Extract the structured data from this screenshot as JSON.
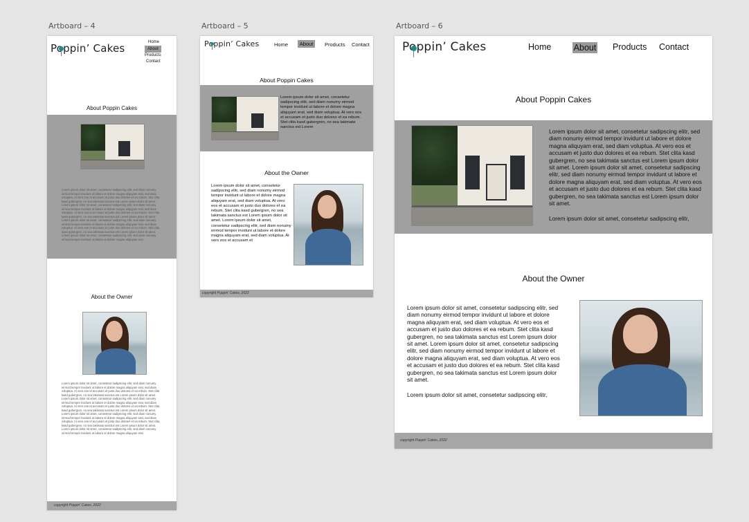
{
  "artboards": [
    {
      "label": "Artboard – 4"
    },
    {
      "label": "Artboard – 5"
    },
    {
      "label": "Artboard – 6"
    }
  ],
  "site": {
    "logo_text": "Poppin’ Cakes",
    "nav": [
      "Home",
      "About",
      "Products",
      "Contact"
    ],
    "active_nav": "About",
    "about_title": "About Poppin Cakes",
    "owner_title": "About the Owner",
    "footer": "copyright Poppin' Cakes, 2022",
    "storefront_image": "storefront-photo",
    "owner_image": "owner-portrait-photo"
  },
  "lorem": {
    "ab4_about": "Lorem ipsum dolor sit amet, consetetur sadipscing elitr, sed diam nonumy eirmod tempor invidunt ut labore et dolore magna aliquyam erat, sed diam voluptua. At vero eos et accusam et justo duo dolores et ea rebum. Stet clita kasd gubergren, no sea takimata sanctus est Lorem ipsum dolor sit amet. Lorem ipsum dolor sit amet, consetetur sadipscing elitr, sed diam nonumy eirmod tempor invidunt ut labore et dolore magna aliquyam erat, sed diam voluptua. At vero eos et accusam et justo duo dolores et ea rebum. Stet clita kasd gubergren, no sea takimata sanctus est Lorem ipsum dolor sit amet. Lorem ipsum dolor sit amet, consetetur sadipscing elitr, sed diam nonumy eirmod tempor invidunt ut labore et dolore magna aliquyam erat, sed diam voluptua. At vero eos et accusam et justo duo dolores et ea rebum. Stet clita kasd gubergren, no sea takimata sanctus est Lorem ipsum dolor sit amet. Lorem ipsum dolor sit amet, consetetur sadipscing elitr, sed diam nonumy eirmod tempor invidunt ut labore et dolore magna aliquyam erat",
    "ab4_owner": "Lorem ipsum dolor sit amet, consetetur sadipscing elitr, sed diam nonumy eirmod tempor invidunt ut labore et dolore magna aliquyam erat, sed diam voluptua. At vero eos et accusam et justo duo dolores et ea rebum. Stet clita kasd gubergren, no sea takimata sanctus est Lorem ipsum dolor sit amet. Lorem ipsum dolor sit amet, consetetur sadipscing elitr, sed diam nonumy eirmod tempor invidunt ut labore et dolore magna aliquyam erat, sed diam voluptua. At vero eos et accusam et justo duo dolores et ea rebum. Stet clita kasd gubergren, no sea takimata sanctus est Lorem ipsum dolor sit amet. Lorem ipsum dolor sit amet, consetetur sadipscing elitr, sed diam nonumy eirmod tempor invidunt ut labore et dolore magna aliquyam erat, sed diam voluptua. At vero eos et accusam et justo duo dolores et ea rebum. Stet clita kasd gubergren, no sea takimata sanctus est Lorem ipsum dolor sit amet. Lorem ipsum dolor sit amet, consetetur sadipscing elitr, sed diam nonumy eirmod tempor invidunt ut labore et dolore magna aliquyam erat",
    "ab5_about": "Lorem ipsum dolor sit amet, consetetur sadipscing elitr, sed diam nonumy eirmod tempor invidunt ut labore et dolore magna aliquyam erat, sed diam voluptua. At vero eos et accusam et justo duo dolores et ea rebum. Stet clita kasd gubergren, no sea takimata sanctus est Lorem",
    "ab5_owner": "Lorem ipsum dolor sit amet, consetetur sadipscing elitr, sed diam nonumy eirmod tempor invidunt ut labore et dolore magna aliquyam erat, sed diam voluptua. At vero eos et accusam et justo duo dolores et ea rebum. Stet clita kasd gubergren, no sea takimata sanctus est Lorem ipsum dolor sit amet. Lorem ipsum dolor sit amet, consetetur sadipscing elitr, sed diam nonumy eirmod tempor invidunt ut labore et dolore magna aliquyam erat, sed diam voluptua. At vero eos et accusam et",
    "ab6_about": "Lorem ipsum dolor sit amet, consetetur sadipscing elitr, sed diam nonumy eirmod tempor invidunt ut labore et dolore magna aliquyam erat, sed diam voluptua. At vero eos et accusam et justo duo dolores et ea rebum. Stet clita kasd gubergren, no sea takimata sanctus est Lorem ipsum dolor sit amet. Lorem ipsum dolor sit amet, consetetur sadipscing elitr, sed diam nonumy eirmod tempor invidunt ut labore et dolore magna aliquyam erat, sed diam voluptua. At vero eos et accusam et justo duo dolores et ea rebum. Stet clita kasd gubergren, no sea takimata sanctus est Lorem ipsum dolor sit amet.",
    "ab6_about_tail": "Lorem ipsum dolor sit amet, consetetur sadipscing elitr,",
    "ab6_owner": "Lorem ipsum dolor sit amet, consetetur sadipscing elitr, sed diam nonumy eirmod tempor invidunt ut labore et dolore magna aliquyam erat, sed diam voluptua. At vero eos et accusam et justo duo dolores et ea rebum. Stet clita kasd gubergren, no sea takimata sanctus est Lorem ipsum dolor sit amet. Lorem ipsum dolor sit amet, consetetur sadipscing elitr, sed diam nonumy eirmod tempor invidunt ut labore et dolore magna aliquyam erat, sed diam voluptua. At vero eos et accusam et justo duo dolores et ea rebum. Stet clita kasd gubergren, no sea takimata sanctus est Lorem ipsum dolor sit amet.",
    "ab6_owner_tail": "Lorem ipsum dolor sit amet, consetetur sadipscing elitr,"
  },
  "colors": {
    "canvas": "#e5e5e5",
    "band": "#a0a0a0",
    "footer": "#a6a6a6",
    "nav_active": "#9a9a9a",
    "logo_dot": "#1c8c8c"
  }
}
